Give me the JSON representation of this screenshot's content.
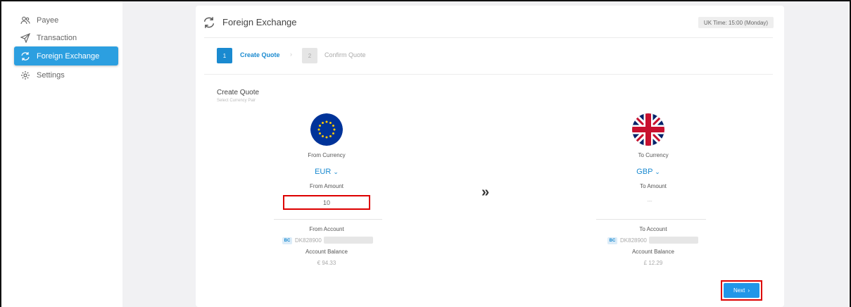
{
  "sidebar": {
    "items": [
      {
        "label": "Payee",
        "icon": "user-icon"
      },
      {
        "label": "Transaction",
        "icon": "send-icon"
      },
      {
        "label": "Foreign Exchange",
        "icon": "exchange-icon"
      },
      {
        "label": "Settings",
        "icon": "gear-icon"
      }
    ],
    "active_color": "#2c9fe0"
  },
  "header": {
    "title": "Foreign Exchange",
    "uk_time": "UK Time: 15:00 (Monday)"
  },
  "steps": [
    {
      "number": "1",
      "label": "Create Quote"
    },
    {
      "number": "2",
      "label": "Confirm Quote"
    }
  ],
  "step_separator": "›",
  "quote": {
    "title": "Create Quote",
    "subtitle": "Select Currency Pair"
  },
  "from": {
    "currency_label": "From Currency",
    "currency": "EUR",
    "amount_label": "From Amount",
    "amount": "10",
    "account_label": "From Account",
    "account_badge": "BC",
    "account_number": "DK828900",
    "balance_label": "Account Balance",
    "balance": "€ 94.33"
  },
  "to": {
    "currency_label": "To Currency",
    "currency": "GBP",
    "amount_label": "To Amount",
    "amount": "---",
    "account_label": "To Account",
    "account_badge": "BC",
    "account_number": "DK828900",
    "balance_label": "Account Balance",
    "balance": "£ 12.29"
  },
  "arrow": "»",
  "next_button": "Next",
  "colors": {
    "accent": "#1a8ad0",
    "button": "#2196e8",
    "highlight": "#dd0000"
  }
}
